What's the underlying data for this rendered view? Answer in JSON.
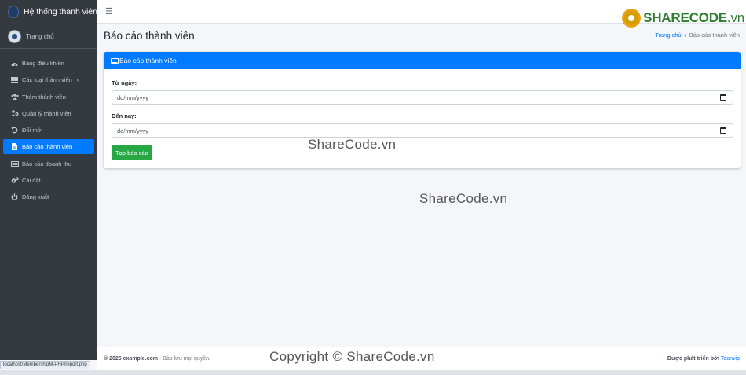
{
  "sidebar": {
    "brand_title": "Hệ thống thành viên",
    "user_name": "Trang chủ",
    "items": [
      {
        "label": "Bảng điều khiển",
        "icon": "dashboard-icon"
      },
      {
        "label": "Các loại thành viên",
        "icon": "list-icon",
        "chevron": "‹"
      },
      {
        "label": "Thêm thành viên",
        "icon": "users-add-icon"
      },
      {
        "label": "Quản lý thành viên",
        "icon": "users-manage-icon"
      },
      {
        "label": "Đổi mới",
        "icon": "undo-icon"
      },
      {
        "label": "Báo cáo thành viên",
        "icon": "file-icon",
        "active": true
      },
      {
        "label": "Báo cáo doanh thu",
        "icon": "money-icon"
      },
      {
        "label": "Cài đặt",
        "icon": "gears-icon"
      },
      {
        "label": "Đăng xuất",
        "icon": "power-icon"
      }
    ]
  },
  "topbar": {
    "menu_icon": "☰",
    "logo_main": "SHARECODE",
    "logo_suffix": ".vn"
  },
  "header": {
    "title": "Báo cáo thành viên",
    "breadcrumb_home": "Trang chủ",
    "breadcrumb_separator": "/",
    "breadcrumb_current": "Báo cáo thành viên"
  },
  "card": {
    "title": "Báo cáo thành viên",
    "from_label": "Từ ngày:",
    "from_placeholder": "dd/mm/yyyy",
    "to_label": "Đến nay:",
    "to_placeholder": "dd/mm/yyyy",
    "submit_label": "Tạo báo cáo"
  },
  "watermarks": {
    "text1": "ShareCode.vn",
    "text2": "ShareCode.vn",
    "text3": "Copyright © ShareCode.vn"
  },
  "footer": {
    "copyright_prefix": "© 2025",
    "site": "example.com",
    "rights": "- Bảo lưu mọi quyền.",
    "developed_by": "Được phát triển bởi",
    "developer": "Toanvip"
  },
  "status_url": "localhost/MembershipM-PHP/report.php",
  "colors": {
    "sidebar_bg": "#343a40",
    "primary": "#007bff",
    "success": "#28a745"
  }
}
